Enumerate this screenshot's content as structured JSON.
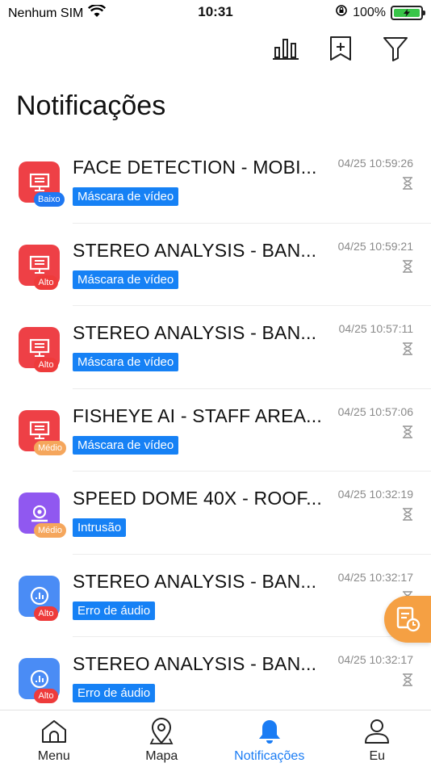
{
  "status_bar": {
    "carrier": "Nenhum SIM",
    "time": "10:31",
    "battery": "100%"
  },
  "toolbar": {
    "stats_icon": "bar-chart-icon",
    "add_icon": "bookmark-add-icon",
    "filter_icon": "filter-icon"
  },
  "page": {
    "title": "Notificações"
  },
  "notifications": [
    {
      "title": "FACE DETECTION - MOBI...",
      "level": "Baixo",
      "tag": "Máscara de vídeo",
      "time": "04/25 10:59:26"
    },
    {
      "title": "STEREO ANALYSIS -  BAN...",
      "level": "Alto",
      "tag": "Máscara de vídeo",
      "time": "04/25 10:59:21"
    },
    {
      "title": "STEREO ANALYSIS -  BAN...",
      "level": "Alto",
      "tag": "Máscara de vídeo",
      "time": "04/25 10:57:11"
    },
    {
      "title": "FISHEYE AI - STAFF AREA...",
      "level": "Médio",
      "tag": "Máscara de vídeo",
      "time": "04/25 10:57:06"
    },
    {
      "title": "SPEED DOME 40X - ROOF...",
      "level": "Médio",
      "tag": "Intrusão",
      "time": "04/25 10:32:19"
    },
    {
      "title": "STEREO ANALYSIS -  BAN...",
      "level": "Alto",
      "tag": "Erro de áudio",
      "time": "04/25 10:32:17"
    },
    {
      "title": "STEREO ANALYSIS -  BAN...",
      "level": "Alto",
      "tag": "Erro de áudio",
      "time": "04/25 10:32:17"
    }
  ],
  "tabs": [
    {
      "label": "Menu",
      "icon": "home-icon"
    },
    {
      "label": "Mapa",
      "icon": "map-pin-icon"
    },
    {
      "label": "Notificações",
      "icon": "bell-icon",
      "active": true
    },
    {
      "label": "Eu",
      "icon": "user-icon"
    }
  ],
  "colors": {
    "accent": "#1a7cf4",
    "tag": "#1681f5",
    "red_avatar": "#ee4046",
    "purple_avatar": "#9058f0",
    "blue_avatar": "#4a8cf5",
    "fab": "#f5a043"
  }
}
